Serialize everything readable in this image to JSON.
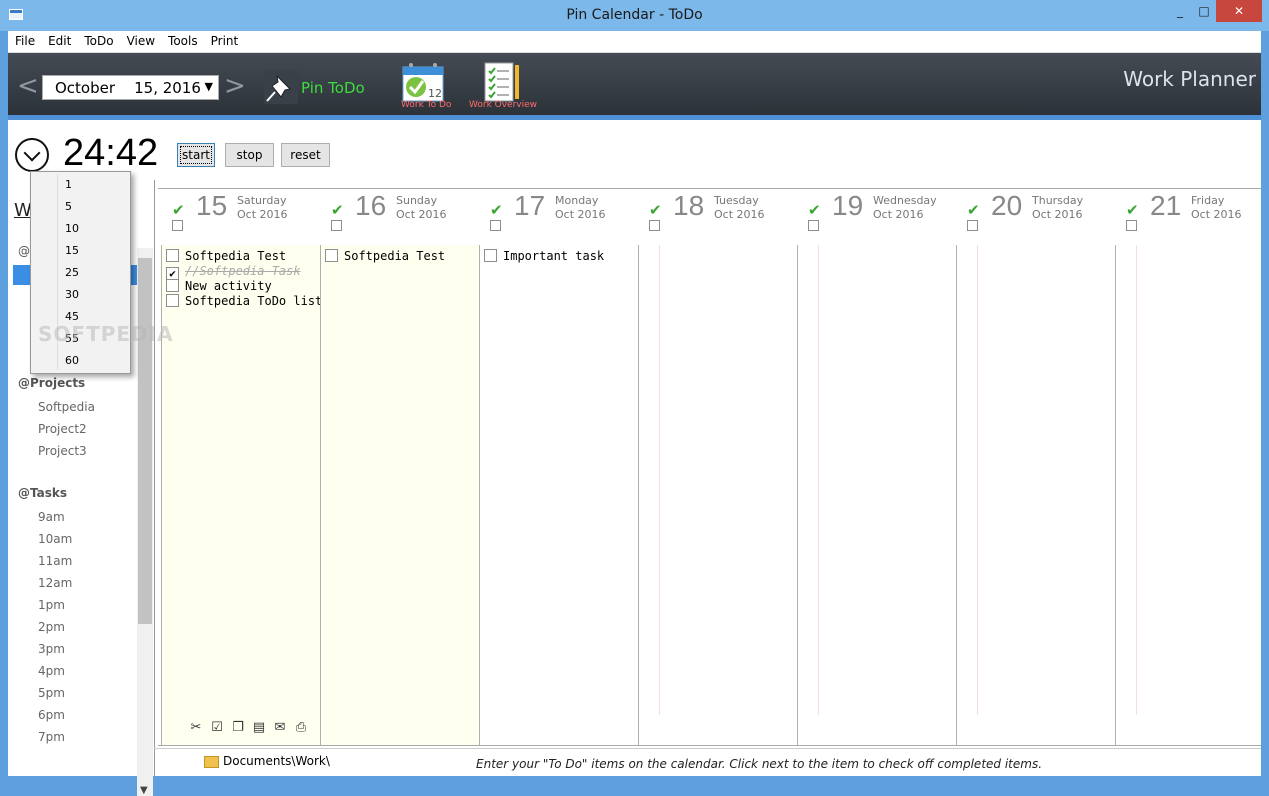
{
  "window": {
    "title": "Pin Calendar - ToDo",
    "minimize": "_",
    "maximize": "□",
    "close": "✕"
  },
  "menu": [
    "File",
    "Edit",
    "ToDo",
    "View",
    "Tools",
    "Print"
  ],
  "toolbar": {
    "prev": "<",
    "next": ">",
    "date_value": "October    15, 2016",
    "pin_label": "Pin ToDo",
    "work_todo_label": "Work To Do",
    "work_overview_label": "Work Overview",
    "app_heading": "Work Planner"
  },
  "timer": {
    "value": "24:42",
    "start": "start",
    "stop": "stop",
    "reset": "reset"
  },
  "interval_popup": {
    "options": [
      "1",
      "5",
      "10",
      "15",
      "25",
      "30",
      "45",
      "55",
      "60"
    ]
  },
  "sidebar": {
    "heading": "W",
    "at_prefix": "@",
    "projects_heading": "@Projects",
    "projects": [
      "Softpedia",
      "Project2",
      "Project3"
    ],
    "tasks_heading": "@Tasks",
    "tasks": [
      "9am",
      "10am",
      "11am",
      "12am",
      "1pm",
      "2pm",
      "3pm",
      "4pm",
      "5pm",
      "6pm",
      "7pm"
    ]
  },
  "days": [
    {
      "num": "15",
      "weekday": "Saturday",
      "month": "Oct 2016",
      "highlight": true,
      "items": [
        {
          "text": "Softpedia Test",
          "done": false
        },
        {
          "text": "//Softpedia Task",
          "done": true
        },
        {
          "text": "New activity",
          "done": false
        },
        {
          "text": "Softpedia ToDo list",
          "done": false
        }
      ]
    },
    {
      "num": "16",
      "weekday": "Sunday",
      "month": "Oct 2016",
      "highlight": true,
      "items": [
        {
          "text": "Softpedia Test",
          "done": false
        }
      ]
    },
    {
      "num": "17",
      "weekday": "Monday",
      "month": "Oct 2016",
      "highlight": false,
      "items": [
        {
          "text": "Important task",
          "done": false
        }
      ]
    },
    {
      "num": "18",
      "weekday": "Tuesday",
      "month": "Oct 2016",
      "highlight": false,
      "items": []
    },
    {
      "num": "19",
      "weekday": "Wednesday",
      "month": "Oct 2016",
      "highlight": false,
      "items": []
    },
    {
      "num": "20",
      "weekday": "Thursday",
      "month": "Oct 2016",
      "highlight": false,
      "items": []
    },
    {
      "num": "21",
      "weekday": "Friday",
      "month": "Oct 2016",
      "highlight": false,
      "items": []
    }
  ],
  "status": {
    "path": "Documents\\Work\\",
    "hint": "Enter your \"To Do\" items on the calendar. Click next to the item to check off completed items."
  },
  "watermark": "SOFTPEDIA",
  "colors": {
    "accent": "#3a8ee6",
    "pin_green": "#3cdc3c",
    "toolbar_label": "#ff6c6c",
    "check_green": "#3aa533"
  }
}
